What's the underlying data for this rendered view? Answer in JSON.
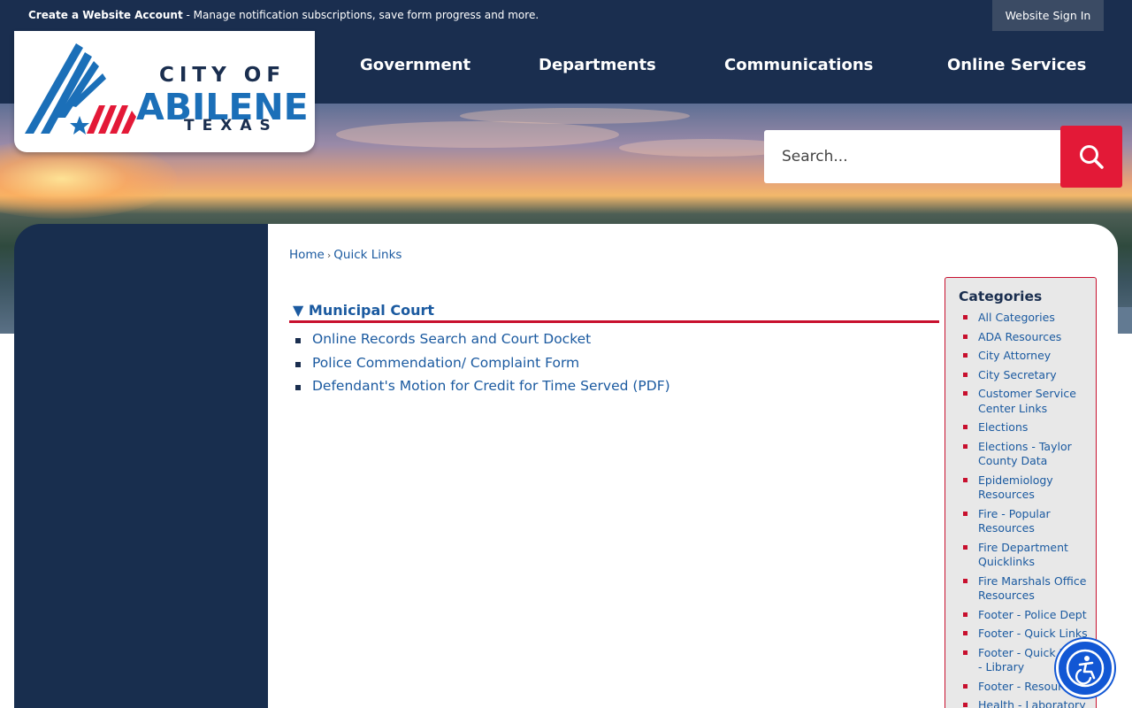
{
  "topbar": {
    "account_link": "Create a Website Account",
    "account_text": " - Manage notification subscriptions, save form progress and more.",
    "signin": "Website Sign In"
  },
  "logo": {
    "line1": "CITY OF",
    "line2": "ABILENE",
    "line3": "TEXAS"
  },
  "nav": {
    "items": [
      "Government",
      "Departments",
      "Communications",
      "Online Services"
    ]
  },
  "search": {
    "placeholder": "Search..."
  },
  "breadcrumb": {
    "home": "Home",
    "separator": "›",
    "current": "Quick Links"
  },
  "section": {
    "toggle": "▼",
    "title": "Municipal Court",
    "links": [
      "Online Records Search and Court Docket",
      "Police Commendation/ Complaint Form",
      "Defendant's Motion for Credit for Time Served (PDF)"
    ]
  },
  "categories": {
    "title": "Categories",
    "items": [
      "All Categories",
      "ADA Resources",
      "City Attorney",
      "City Secretary",
      "Customer Service Center Links",
      "Elections",
      "Elections - Taylor County Data",
      "Epidemiology Resources",
      "Fire - Popular Resources",
      "Fire Department Quicklinks",
      "Fire Marshals Office Resources",
      "Footer - Police Dept",
      "Footer - Quick Links",
      "Footer - Quick Links - Library",
      "Footer - Resources",
      "Health - Laboratory"
    ]
  },
  "colors": {
    "navy": "#1a2e4f",
    "brand_blue": "#1b6fb8",
    "accent_red": "#e31937",
    "link_blue": "#1b5aa0"
  },
  "icons": {
    "search": "search-icon",
    "accessibility": "accessibility-icon"
  }
}
